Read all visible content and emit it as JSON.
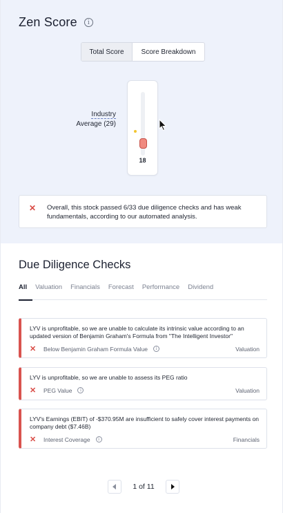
{
  "zen": {
    "title": "Zen Score",
    "toggle": {
      "total": "Total Score",
      "breakdown": "Score Breakdown"
    },
    "industry_label_1": "Industry",
    "industry_label_2": "Average (29)",
    "score": "18",
    "summary": "Overall, this stock passed 6/33 due diligence checks and has weak fundamentals, according to our automated analysis."
  },
  "dd": {
    "title": "Due Diligence Checks",
    "tabs": [
      "All",
      "Valuation",
      "Financials",
      "Forecast",
      "Performance",
      "Dividend"
    ],
    "checks": [
      {
        "text": "LYV is unprofitable, so we are unable to calculate its intrinsic value according to an updated version of Benjamin Graham's Formula from \"The Intelligent Investor\"",
        "label": "Below Benjamin Graham Formula Value",
        "category": "Valuation"
      },
      {
        "text": "LYV is unprofitable, so we are unable to assess its PEG ratio",
        "label": "PEG Value",
        "category": "Valuation"
      },
      {
        "text": "LYV's Earnings (EBIT) of -$370.95M are insufficient to safely cover interest payments on company debt ($7.46B)",
        "label": "Interest Coverage",
        "category": "Financials"
      }
    ],
    "pager": "1 of 11"
  },
  "colors": {
    "fail": "#d9534f",
    "accent_bg": "#eef2fb",
    "industry_dot": "#f2c530"
  },
  "icons": {
    "info": "info-icon",
    "fail": "x-mark-icon",
    "prev": "chevron-left-icon",
    "next": "chevron-right-icon"
  }
}
